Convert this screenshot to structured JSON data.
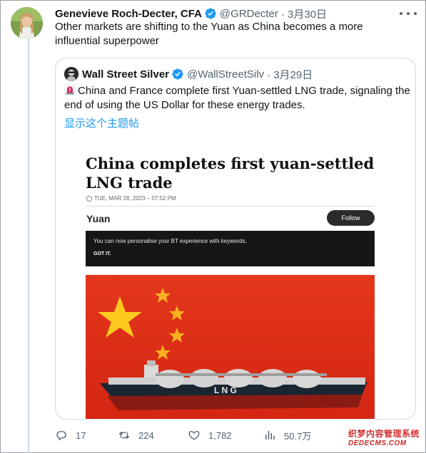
{
  "tweet": {
    "author_name": "Genevieve Roch-Decter, CFA",
    "author_handle": "@GRDecter",
    "date": "· 3月30日",
    "text": "Other markets are shifting to the Yuan as China becomes a more influential superpower",
    "verified_color": "#1d9bf0"
  },
  "quoted": {
    "author_name": "Wall Street Silver",
    "author_handle": "@WallStreetSilv",
    "date": "· 3月29日",
    "text": "China and France complete first Yuan-settled LNG trade, signaling the end of using the US Dollar for these energy trades.",
    "show_thread": "显示这个主题帖",
    "icon": "rotating-light-emoji"
  },
  "media": {
    "headline": "China completes first yuan-settled LNG trade",
    "dateline": "TUE, MAR 28, 2023 – 07:52 PM",
    "topic": "Yuan",
    "follow_label": "Follow",
    "banner_text": "You can now personalise your BT experience with keywords.",
    "banner_button": "GOT IT.",
    "ship_label": "L N G"
  },
  "actions": {
    "replies": "17",
    "retweets": "224",
    "likes": "1,782",
    "views": "50.7万"
  },
  "watermark": {
    "line1": "织梦内容管理系统",
    "line2": "DEDECMS.COM"
  },
  "colors": {
    "link": "#1d9bf0",
    "muted": "#536471",
    "flag_red": "#de2910",
    "flag_star": "#ffde00"
  }
}
